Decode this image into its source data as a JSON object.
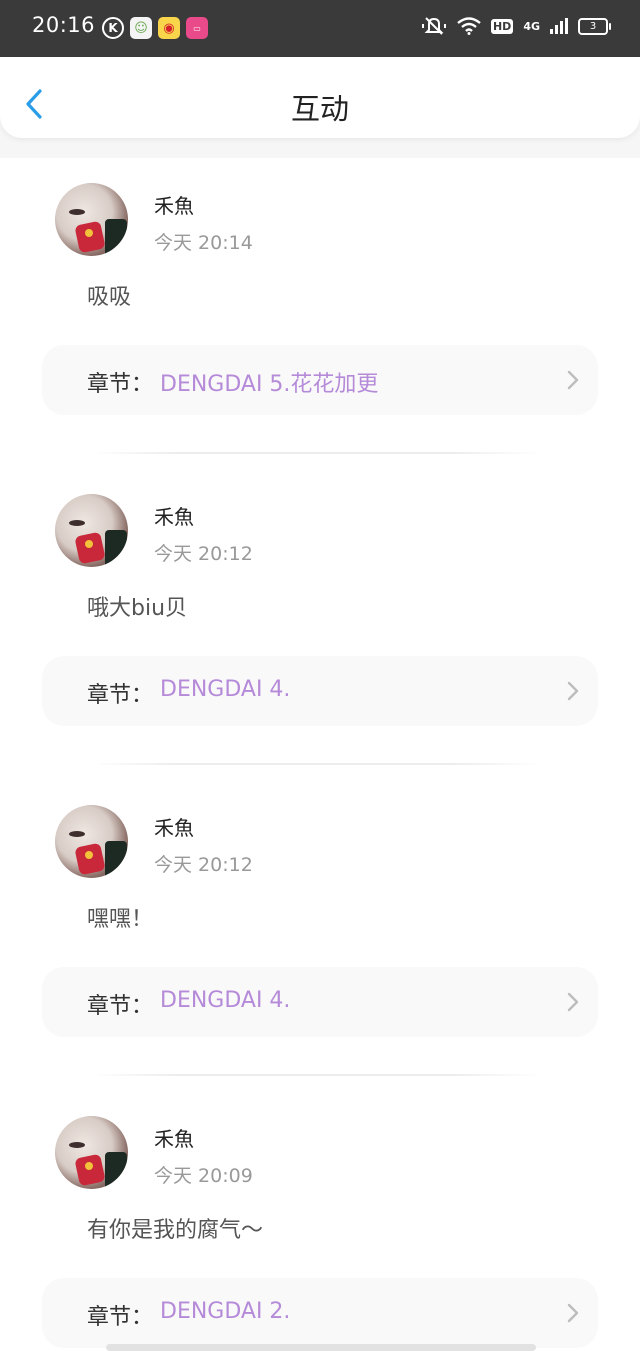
{
  "status_bar": {
    "time": "20:16",
    "app_icons": [
      "k-app-icon",
      "bot-app-icon",
      "weibo-icon",
      "bilibili-icon"
    ],
    "hd_label": "HD",
    "network": "4G",
    "battery": "3"
  },
  "header": {
    "title": "互动",
    "back_icon": "chevron-left-icon"
  },
  "colors": {
    "accent_blue": "#2a9de8",
    "chapter_purple": "#b58ad8",
    "status_bar_bg": "#3a3a3a"
  },
  "chapter_prefix": "章节：",
  "entries": [
    {
      "user": "禾魚",
      "time": "今天 20:14",
      "comment": "吸吸",
      "chapter": "DENGDAI 5.花花加更"
    },
    {
      "user": "禾魚",
      "time": "今天 20:12",
      "comment": "哦大biu贝",
      "chapter": "DENGDAI 4."
    },
    {
      "user": "禾魚",
      "time": "今天 20:12",
      "comment": "嘿嘿！",
      "chapter": "DENGDAI 4."
    },
    {
      "user": "禾魚",
      "time": "今天 20:09",
      "comment": "有你是我的腐气～",
      "chapter": "DENGDAI 2."
    }
  ]
}
